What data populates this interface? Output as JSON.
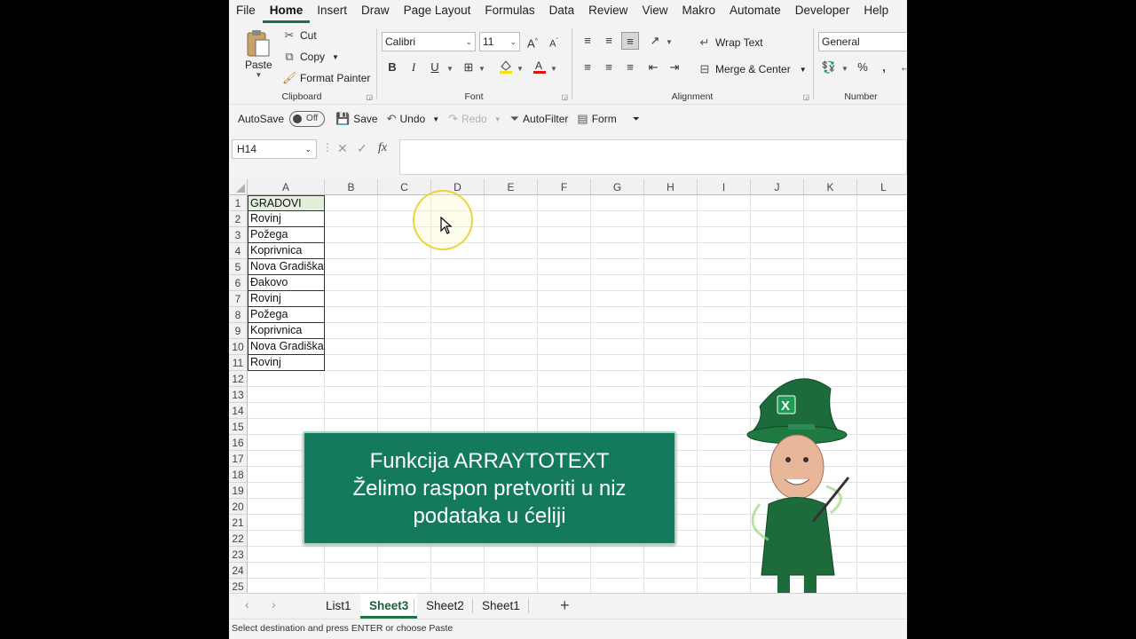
{
  "menu": [
    "File",
    "Home",
    "Insert",
    "Draw",
    "Page Layout",
    "Formulas",
    "Data",
    "Review",
    "View",
    "Makro",
    "Automate",
    "Developer",
    "Help"
  ],
  "menu_active": "Home",
  "ribbon": {
    "clipboard": {
      "label": "Clipboard",
      "paste": "Paste",
      "cut": "Cut",
      "copy": "Copy",
      "format_painter": "Format Painter"
    },
    "font": {
      "label": "Font",
      "font_name": "Calibri",
      "font_size": "11",
      "bold": "B",
      "italic": "I",
      "underline": "U"
    },
    "alignment": {
      "label": "Alignment",
      "wrap_text": "Wrap Text",
      "merge_center": "Merge & Center"
    },
    "number": {
      "label": "Number",
      "format": "General"
    }
  },
  "qat": {
    "autosave": "AutoSave",
    "toggle": "Off",
    "save": "Save",
    "undo": "Undo",
    "redo": "Redo",
    "autofilter": "AutoFilter",
    "form": "Form"
  },
  "formula_bar": {
    "name_box": "H14",
    "formula": ""
  },
  "grid": {
    "columns": [
      "A",
      "B",
      "C",
      "D",
      "E",
      "F",
      "G",
      "H",
      "I",
      "J",
      "K",
      "L"
    ],
    "rows": [
      "1",
      "2",
      "3",
      "4",
      "5",
      "6",
      "7",
      "8",
      "9",
      "10",
      "11",
      "12",
      "13",
      "14",
      "15",
      "16",
      "17",
      "18",
      "19",
      "20",
      "21",
      "22",
      "23",
      "24",
      "25"
    ],
    "columnA": [
      "GRADOVI",
      "Rovinj",
      "Požega",
      "Koprivnica",
      "Nova Gradiška",
      "Đakovo",
      "Rovinj",
      "Požega",
      "Koprivnica",
      "Nova Gradiška",
      "Rovinj"
    ]
  },
  "callout": {
    "line1": "Funkcija ARRAYTOTEXT",
    "line2": "Želimo raspon pretvoriti u niz",
    "line3": "podataka u ćeliji"
  },
  "sheets": [
    "List1",
    "Sheet3",
    "Sheet2",
    "Sheet1"
  ],
  "active_sheet": "Sheet3",
  "status": "Select destination and press ENTER or choose Paste",
  "colors": {
    "accent": "#1e7145",
    "callout_bg": "#137a5e",
    "header_fill": "#e2efda"
  }
}
